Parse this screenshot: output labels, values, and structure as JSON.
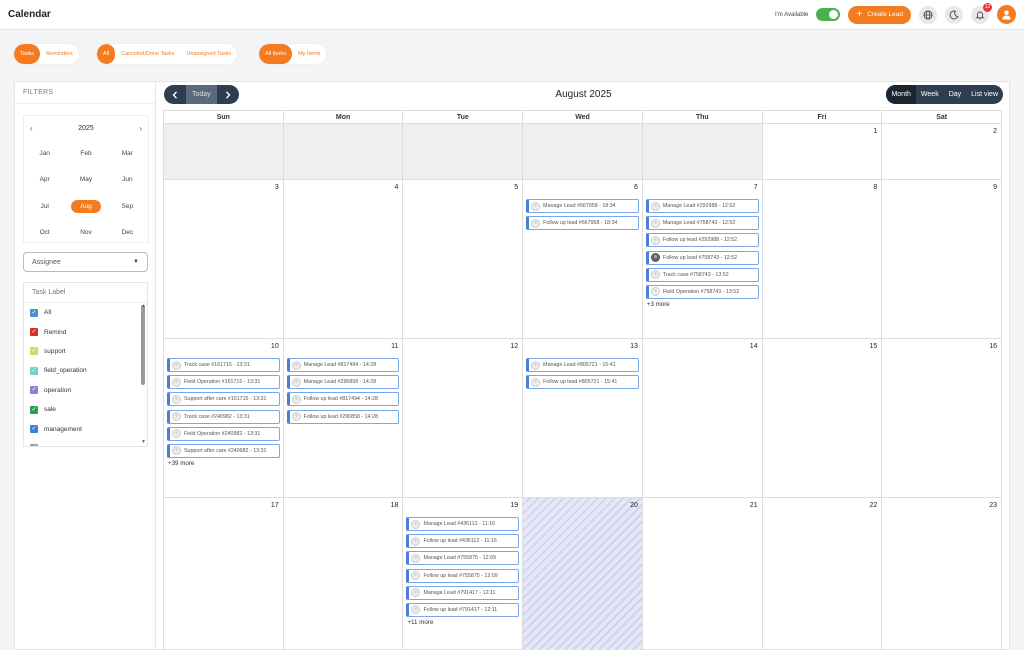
{
  "header": {
    "title": "Calendar",
    "availability_label": "I'm Available",
    "create_lead_label": "Create Lead",
    "notification_count": "12"
  },
  "pills": {
    "type": [
      {
        "label": "Tasks",
        "active": true
      },
      {
        "label": "Reminders",
        "active": false
      }
    ],
    "status": [
      {
        "label": "All",
        "active": true
      },
      {
        "label": "Canceled/Done Tasks",
        "active": false
      },
      {
        "label": "Unassigned Tasks",
        "active": false
      }
    ],
    "scope": [
      {
        "label": "All Items",
        "active": true
      },
      {
        "label": "My Items",
        "active": false
      }
    ]
  },
  "filters": {
    "title": "FILTERS",
    "year": "2025",
    "months": [
      "Jan",
      "Feb",
      "Mar",
      "Apr",
      "May",
      "Jun",
      "Jul",
      "Aug",
      "Sep",
      "Oct",
      "Nov",
      "Dec"
    ],
    "active_month": "Aug",
    "assignee_placeholder": "Assignee",
    "task_label_title": "Task Label",
    "labels": [
      {
        "label": "All",
        "color": "#4a90d9"
      },
      {
        "label": "Remind",
        "color": "#d32f2f"
      },
      {
        "label": "support",
        "color": "#cddc6a"
      },
      {
        "label": "field_operation",
        "color": "#6fd3c4"
      },
      {
        "label": "operation",
        "color": "#8a7fd6"
      },
      {
        "label": "sale",
        "color": "#2e9e4f"
      },
      {
        "label": "management",
        "color": "#3f7fd9"
      },
      {
        "label": "",
        "color": "#9e9e9e"
      }
    ]
  },
  "calendar": {
    "title": "August 2025",
    "today_label": "Today",
    "views": [
      {
        "label": "Month",
        "active": true
      },
      {
        "label": "Week",
        "active": false
      },
      {
        "label": "Day",
        "active": false
      },
      {
        "label": "List view",
        "active": false
      }
    ],
    "weekdays": [
      "Sun",
      "Mon",
      "Tue",
      "Wed",
      "Thu",
      "Fri",
      "Sat"
    ],
    "weeks": [
      [
        {
          "day": "",
          "other": true
        },
        {
          "day": "",
          "other": true
        },
        {
          "day": "",
          "other": true
        },
        {
          "day": "",
          "other": true
        },
        {
          "day": "",
          "other": true
        },
        {
          "day": "1"
        },
        {
          "day": "2"
        }
      ],
      [
        {
          "day": "3"
        },
        {
          "day": "4"
        },
        {
          "day": "5"
        },
        {
          "day": "6",
          "events": [
            {
              "text": "Manage Lead #667958 - 18:34"
            },
            {
              "text": "Follow up lead #667958 - 18:34"
            }
          ]
        },
        {
          "day": "7",
          "events": [
            {
              "text": "Manage Lead #292988 - 12:52"
            },
            {
              "text": "Manage Lead #758743 - 12:52"
            },
            {
              "text": "Follow up lead #292988 - 12:52"
            },
            {
              "text": "Follow up lead #758743 - 12:52",
              "photo": true
            },
            {
              "text": "Track case #758743 - 13:52"
            },
            {
              "text": "Field Operation #758743 - 13:52"
            }
          ],
          "more": "+3 more"
        },
        {
          "day": "8"
        },
        {
          "day": "9"
        }
      ],
      [
        {
          "day": "10",
          "events": [
            {
              "text": "Track case #161715 - 13:31"
            },
            {
              "text": "Field Operation #161715 - 13:31"
            },
            {
              "text": "Support after care #161715 - 13:31"
            },
            {
              "text": "Track case #240982 - 13:31"
            },
            {
              "text": "Field Operation #240982 - 13:31"
            },
            {
              "text": "Support after care #240982 - 13:31"
            }
          ],
          "more": "+39 more"
        },
        {
          "day": "11",
          "events": [
            {
              "text": "Manage Lead #817494 - 14:28"
            },
            {
              "text": "Manage Lead #290858 - 14:28"
            },
            {
              "text": "Follow up lead #817494 - 14:28"
            },
            {
              "text": "Follow up lead #290858 - 14:28"
            }
          ]
        },
        {
          "day": "12"
        },
        {
          "day": "13",
          "events": [
            {
              "text": "Manage Lead #805721 - 15:41"
            },
            {
              "text": "Follow up lead #805721 - 15:41"
            }
          ]
        },
        {
          "day": "14"
        },
        {
          "day": "15"
        },
        {
          "day": "16"
        }
      ],
      [
        {
          "day": "17"
        },
        {
          "day": "18"
        },
        {
          "day": "19",
          "events": [
            {
              "text": "Manage Lead #436112 - 11:16"
            },
            {
              "text": "Follow up lead #436112 - 11:16"
            },
            {
              "text": "Manage Lead #755875 - 12:09"
            },
            {
              "text": "Follow up lead #755875 - 12:09"
            },
            {
              "text": "Manage Lead #791417 - 12:11"
            },
            {
              "text": "Follow up lead #791417 - 12:11"
            }
          ],
          "more": "+11 more"
        },
        {
          "day": "20",
          "today": true
        },
        {
          "day": "21"
        },
        {
          "day": "22"
        },
        {
          "day": "23"
        }
      ],
      [
        {
          "day": ""
        },
        {
          "day": ""
        },
        {
          "day": ""
        },
        {
          "day": ""
        },
        {
          "day": ""
        },
        {
          "day": ""
        },
        {
          "day": ""
        }
      ]
    ]
  }
}
